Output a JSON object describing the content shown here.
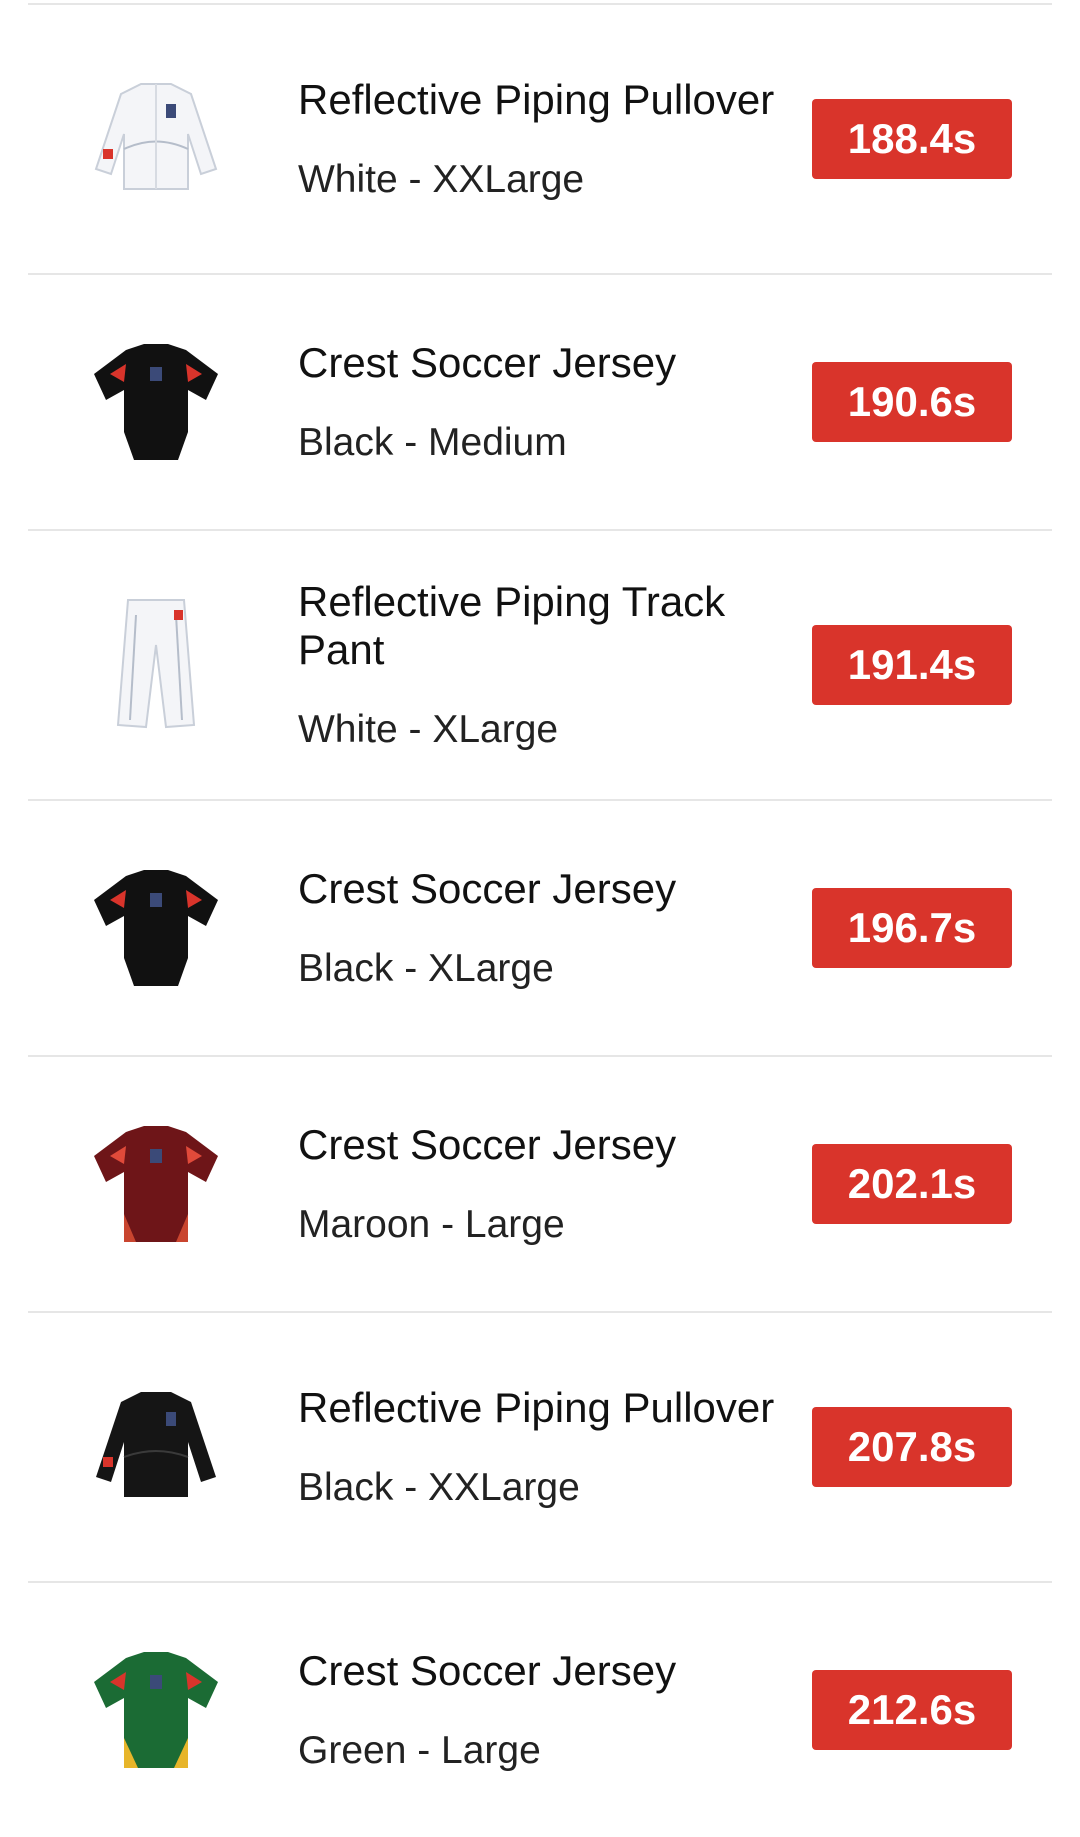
{
  "items": [
    {
      "name": "Reflective Piping Pullover",
      "variant": "White - XXLarge",
      "time": "188.4s",
      "icon": "pullover-white-icon",
      "color": "#f4f5f8",
      "accent": "#d9342b"
    },
    {
      "name": "Crest Soccer Jersey",
      "variant": "Black - Medium",
      "time": "190.6s",
      "icon": "jersey-black-icon",
      "color": "#111111",
      "accent": "#ffffff"
    },
    {
      "name": "Reflective Piping Track Pant",
      "variant": "White - XLarge",
      "time": "191.4s",
      "icon": "track-pant-white-icon",
      "color": "#f4f5f8",
      "accent": "#d9342b"
    },
    {
      "name": "Crest Soccer Jersey",
      "variant": "Black - XLarge",
      "time": "196.7s",
      "icon": "jersey-black-icon",
      "color": "#111111",
      "accent": "#ffffff"
    },
    {
      "name": "Crest Soccer Jersey",
      "variant": "Maroon - Large",
      "time": "202.1s",
      "icon": "jersey-maroon-icon",
      "color": "#6e1518",
      "accent": "#c9452f"
    },
    {
      "name": "Reflective Piping Pullover",
      "variant": "Black - XXLarge",
      "time": "207.8s",
      "icon": "pullover-black-icon",
      "color": "#151515",
      "accent": "#d9342b"
    },
    {
      "name": "Crest Soccer Jersey",
      "variant": "Green - Large",
      "time": "212.6s",
      "icon": "jersey-green-icon",
      "color": "#1b6b34",
      "accent": "#e7b52a"
    }
  ],
  "colors": {
    "badge": "#d9342b",
    "divider": "#e6e6e6"
  }
}
